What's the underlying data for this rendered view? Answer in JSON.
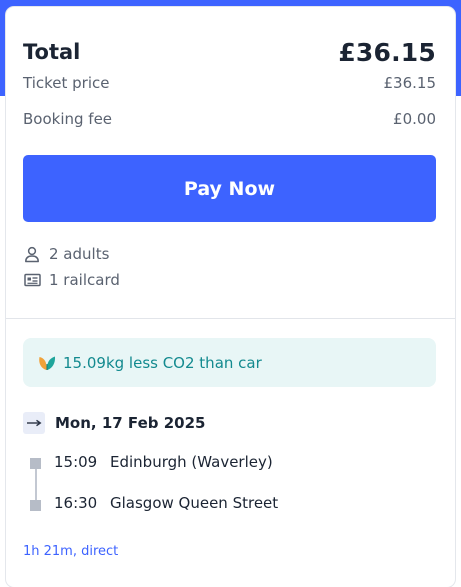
{
  "summary": {
    "total_label": "Total",
    "total_amount": "£36.15",
    "ticket_price_label": "Ticket price",
    "ticket_price_value": "£36.15",
    "booking_fee_label": "Booking fee",
    "booking_fee_value": "£0.00"
  },
  "pay_button": {
    "label": "Pay Now"
  },
  "passengers": {
    "adults": "2 adults",
    "railcards": "1 railcard"
  },
  "eco": {
    "text": "15.09kg less CO2 than car"
  },
  "journey": {
    "date": "Mon, 17 Feb 2025",
    "departure_time": "15:09",
    "departure_station": "Edinburgh (Waverley)",
    "arrival_time": "16:30",
    "arrival_station": "Glasgow Queen Street",
    "duration": "1h 21m, direct"
  },
  "colors": {
    "brand_blue": "#3d63ff",
    "eco_teal": "#138a8f",
    "eco_background": "#e8f6f6"
  },
  "icons": {
    "adults": "person-icon",
    "railcard": "railcard-icon",
    "eco": "leaf-icon",
    "direction": "arrow-right-icon"
  }
}
